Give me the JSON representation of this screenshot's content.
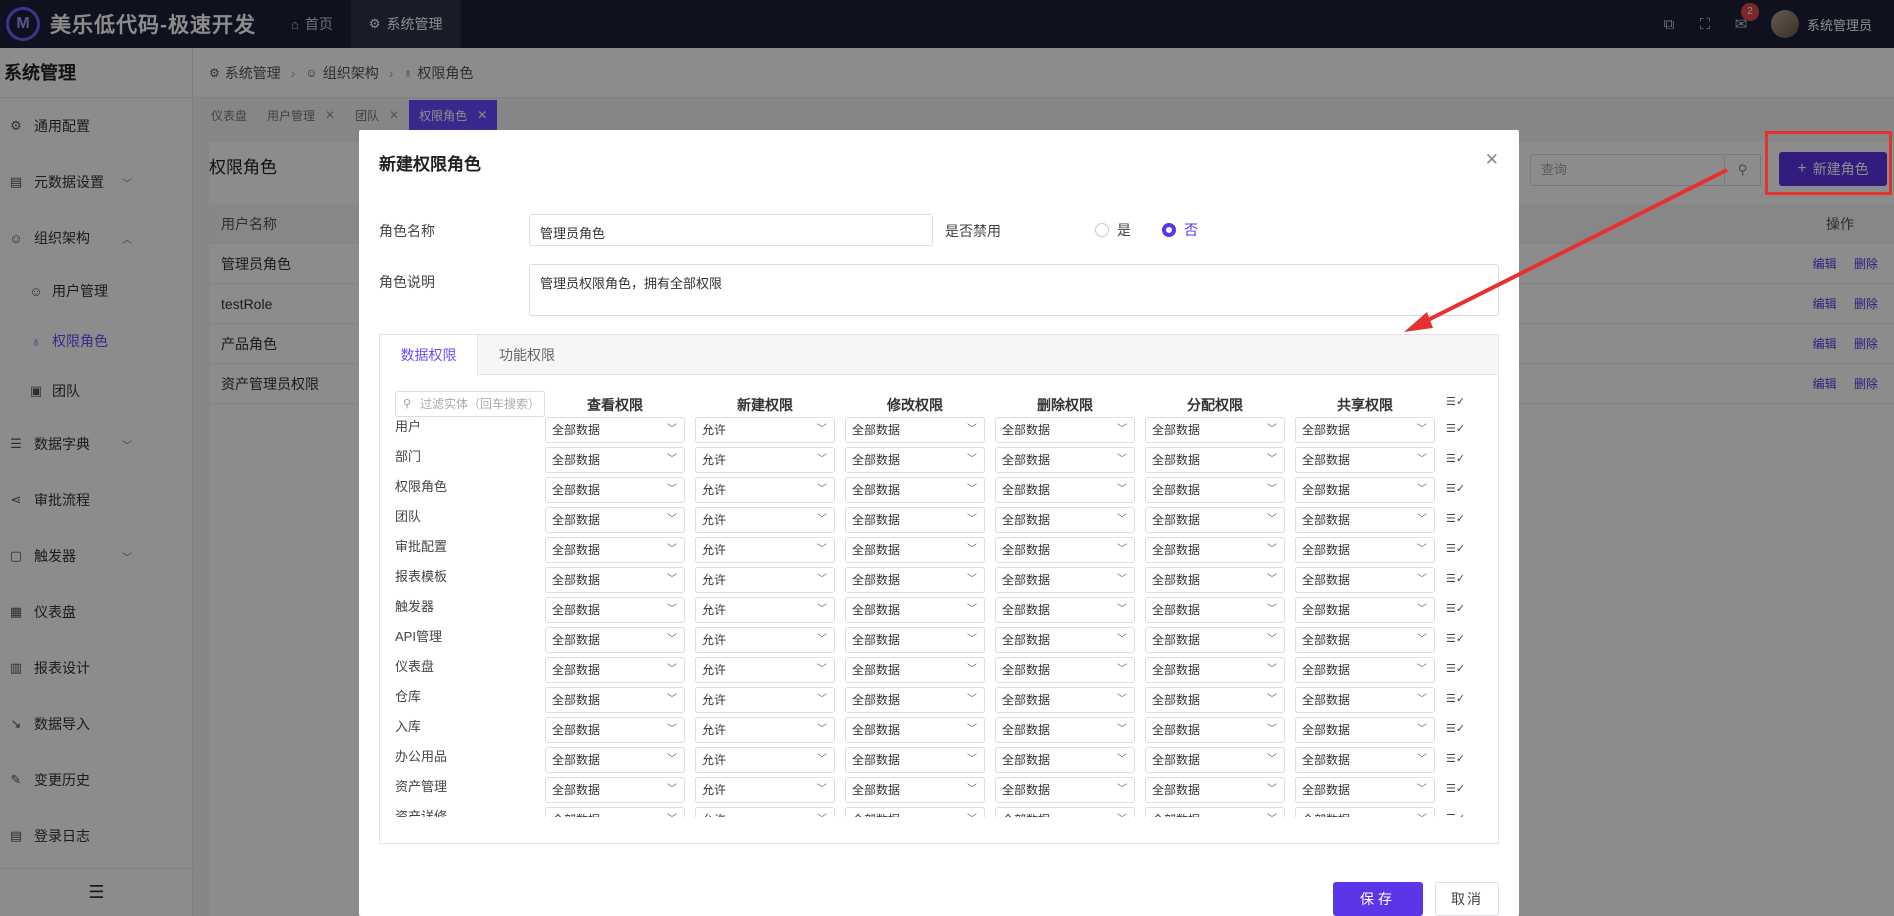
{
  "app": {
    "logo": "M",
    "title": "美乐低代码-极速开发"
  },
  "topnav": [
    {
      "icon": "home-icon",
      "label": "首页"
    },
    {
      "icon": "gear-icon",
      "label": "系统管理"
    }
  ],
  "header_right": {
    "notification_count": "2",
    "user_name": "系统管理员"
  },
  "sidebar": {
    "title": "系统管理",
    "items": [
      {
        "label": "通用配置",
        "icon": "gear-icon"
      },
      {
        "label": "元数据设置",
        "icon": "database-icon"
      },
      {
        "label": "组织架构",
        "icon": "user-icon"
      },
      {
        "label": "用户管理",
        "icon": "user-icon"
      },
      {
        "label": "权限角色",
        "icon": "key-icon"
      },
      {
        "label": "团队",
        "icon": "team-icon"
      },
      {
        "label": "数据字典",
        "icon": "sliders-icon"
      },
      {
        "label": "审批流程",
        "icon": "share-icon"
      },
      {
        "label": "触发器",
        "icon": "chip-icon"
      },
      {
        "label": "仪表盘",
        "icon": "grid-icon"
      },
      {
        "label": "报表设计",
        "icon": "report-icon"
      },
      {
        "label": "数据导入",
        "icon": "import-icon"
      },
      {
        "label": "变更历史",
        "icon": "edit-icon"
      },
      {
        "label": "登录日志",
        "icon": "log-icon"
      }
    ]
  },
  "breadcrumb": [
    "系统管理",
    "组织架构",
    "权限角色"
  ],
  "tabs": [
    "仪表盘",
    "用户管理",
    "团队",
    "权限角色"
  ],
  "page": {
    "title": "权限角色",
    "search_placeholder": "查询",
    "new_button": "新建角色",
    "table_header": {
      "name": "用户名称",
      "ops": "操作"
    },
    "rows": [
      "管理员角色",
      "testRole",
      "产品角色",
      "资产管理员权限"
    ],
    "edit_label": "编辑",
    "delete_label": "删除"
  },
  "modal": {
    "title": "新建权限角色",
    "role_name_label": "角色名称",
    "role_name_value": "管理员角色",
    "disabled_label": "是否禁用",
    "radio_yes": "是",
    "radio_no": "否",
    "desc_label": "角色说明",
    "desc_value": "管理员权限角色，拥有全部权限",
    "perm_tabs": [
      "数据权限",
      "功能权限"
    ],
    "filter_placeholder": "过滤实体（回车搜索）",
    "columns": [
      "查看权限",
      "新建权限",
      "修改权限",
      "删除权限",
      "分配权限",
      "共享权限"
    ],
    "col_values": [
      "全部数据",
      "允许",
      "全部数据",
      "全部数据",
      "全部数据",
      "全部数据"
    ],
    "entities": [
      "用户",
      "部门",
      "权限角色",
      "团队",
      "审批配置",
      "报表模板",
      "触发器",
      "API管理",
      "仪表盘",
      "仓库",
      "入库",
      "办公用品",
      "资产管理",
      "资产详修"
    ],
    "save": "保存",
    "cancel": "取消"
  },
  "colors": {
    "accent": "#5b36e8",
    "topbar": "#1d2238",
    "annotation": "#e5322f"
  }
}
